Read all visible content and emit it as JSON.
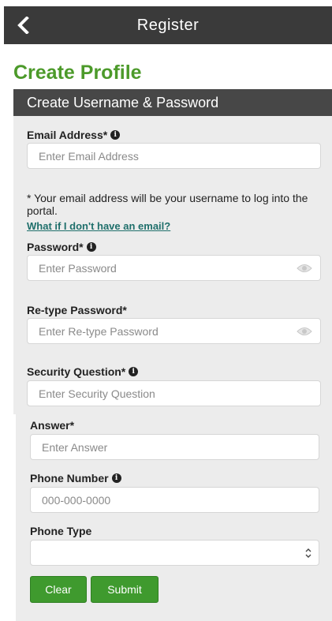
{
  "header": {
    "title": "Register",
    "back_icon": "chevron-left-icon"
  },
  "page": {
    "title": "Create Profile"
  },
  "section": {
    "title": "Create Username & Password"
  },
  "email": {
    "label": "Email Address*",
    "placeholder": "Enter Email Address",
    "value": ""
  },
  "note": {
    "text": "* Your email address will be your username to log into the portal.",
    "link": "What if I don't have an email?"
  },
  "password": {
    "label": "Password*",
    "placeholder": "Enter Password",
    "value": ""
  },
  "retype_password": {
    "label": "Re-type Password*",
    "placeholder": "Enter Re-type Password",
    "value": ""
  },
  "security_question": {
    "label": "Security Question*",
    "placeholder": "Enter Security Question",
    "value": ""
  },
  "answer": {
    "label": "Answer*",
    "placeholder": "Enter Answer",
    "value": ""
  },
  "phone_number": {
    "label": "Phone Number",
    "placeholder": "000-000-0000",
    "value": ""
  },
  "phone_type": {
    "label": "Phone Type",
    "selected": ""
  },
  "buttons": {
    "clear": "Clear",
    "submit": "Submit"
  },
  "colors": {
    "brand_green": "#4c9a2a",
    "button_green": "#3f9a2e",
    "header_dark": "#3a3a3a",
    "link_teal": "#1f6f6b"
  }
}
